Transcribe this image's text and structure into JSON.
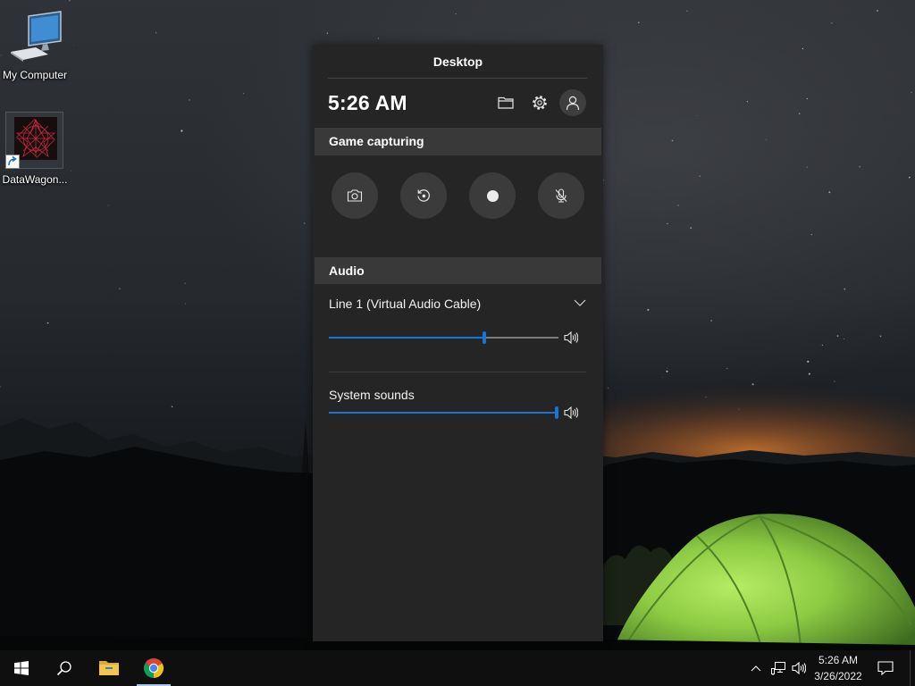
{
  "desktop": {
    "icons": [
      {
        "label": "My Computer",
        "icon": "computer-icon"
      },
      {
        "label": "DataWagon...",
        "icon": "datawagon-app-icon",
        "shortcut": true
      }
    ]
  },
  "game_bar": {
    "title": "Desktop",
    "time": "5:26 AM",
    "header_buttons": [
      {
        "icon": "folder-icon"
      },
      {
        "icon": "gear-icon"
      },
      {
        "icon": "user-icon"
      }
    ],
    "capture": {
      "heading": "Game capturing",
      "buttons": [
        {
          "icon": "camera-icon"
        },
        {
          "icon": "replay-icon"
        },
        {
          "icon": "record-dot-icon"
        },
        {
          "icon": "mic-off-icon"
        }
      ]
    },
    "audio": {
      "heading": "Audio",
      "dropdown_icon": "chevron-down-icon",
      "device": {
        "label": "Line 1 (Virtual Audio Cable)",
        "volume_percent": 68,
        "icon": "speaker-icon"
      },
      "system": {
        "label": "System sounds",
        "volume_percent": 100,
        "icon": "speaker-icon"
      }
    }
  },
  "taskbar": {
    "pinned": [
      {
        "icon": "windows-start-icon"
      },
      {
        "icon": "search-icon"
      },
      {
        "icon": "file-explorer-icon"
      },
      {
        "icon": "chrome-icon",
        "active": true
      }
    ],
    "tray": {
      "icons": [
        "chevron-up-icon",
        "network-icon",
        "volume-icon",
        "notification-icon"
      ],
      "time": "5:26 AM",
      "date": "3/26/2022"
    }
  },
  "colors": {
    "panel_bg": "#252525",
    "section_header_bg": "#393939",
    "button_bg": "#3b3b3b",
    "accent": "#1a73d6",
    "slider_track": "#7c7c7c",
    "taskbar_bg": "#0f0f0f",
    "text": "#ffffff"
  }
}
